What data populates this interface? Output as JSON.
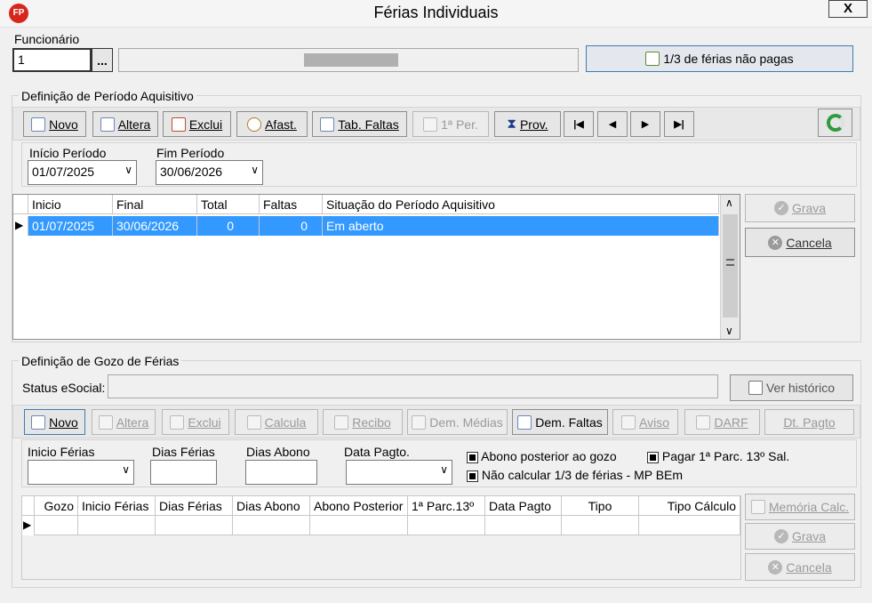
{
  "window": {
    "title": "Férias Individuais",
    "close": "X",
    "logo": "FP"
  },
  "funcionario": {
    "label": "Funcionário",
    "code": "1",
    "lookup": "...",
    "name": "",
    "third_button": "1/3 de férias não pagas"
  },
  "periodo": {
    "group_label": "Definição de Período Aquisitivo",
    "toolbar": {
      "novo": "Novo",
      "altera": "Altera",
      "exclui": "Exclui",
      "afast": "Afast.",
      "tab_faltas": "Tab. Faltas",
      "primeira_per": "1ª Per.",
      "prov": "Prov.",
      "first": "|◀",
      "prev": "◀",
      "next": "▶",
      "last": "▶|"
    },
    "inicio_label": "Início Período",
    "inicio_value": "01/07/2025",
    "fim_label": "Fim Período",
    "fim_value": "30/06/2026",
    "columns": [
      "Inicio",
      "Final",
      "Total",
      "Faltas",
      "Situação do Período Aquisitivo"
    ],
    "rows": [
      {
        "inicio": "01/07/2025",
        "final": "30/06/2026",
        "total": "0",
        "faltas": "0",
        "situacao": "Em aberto"
      }
    ],
    "grava": "Grava",
    "cancela": "Cancela"
  },
  "gozo": {
    "group_label": "Definição de Gozo de Férias",
    "status_label": "Status eSocial:",
    "status_value": "",
    "ver_historico": "Ver histórico",
    "toolbar": {
      "novo": "Novo",
      "altera": "Altera",
      "exclui": "Exclui",
      "calcula": "Calcula",
      "recibo": "Recibo",
      "dem_medias": "Dem. Médias",
      "dem_faltas": "Dem. Faltas",
      "aviso": "Aviso",
      "darf": "DARF",
      "dt_pagto": "Dt. Pagto"
    },
    "inicio_ferias_label": "Inicio Férias",
    "dias_ferias_label": "Dias Férias",
    "dias_abono_label": "Dias Abono",
    "data_pagto_label": "Data Pagto.",
    "abono_posterior": "Abono posterior ao gozo",
    "pagar_13": "Pagar 1ª Parc. 13º Sal.",
    "nao_calcular": "Não calcular 1/3 de férias - MP BEm",
    "columns": [
      "Gozo",
      "Inicio Férias",
      "Dias Férias",
      "Dias Abono",
      "Abono Posterior",
      "1ª Parc.13º",
      "Data Pagto",
      "Tipo",
      "Tipo Cálculo"
    ],
    "memoria": "Memória Calc.",
    "grava": "Grava",
    "cancela": "Cancela"
  }
}
